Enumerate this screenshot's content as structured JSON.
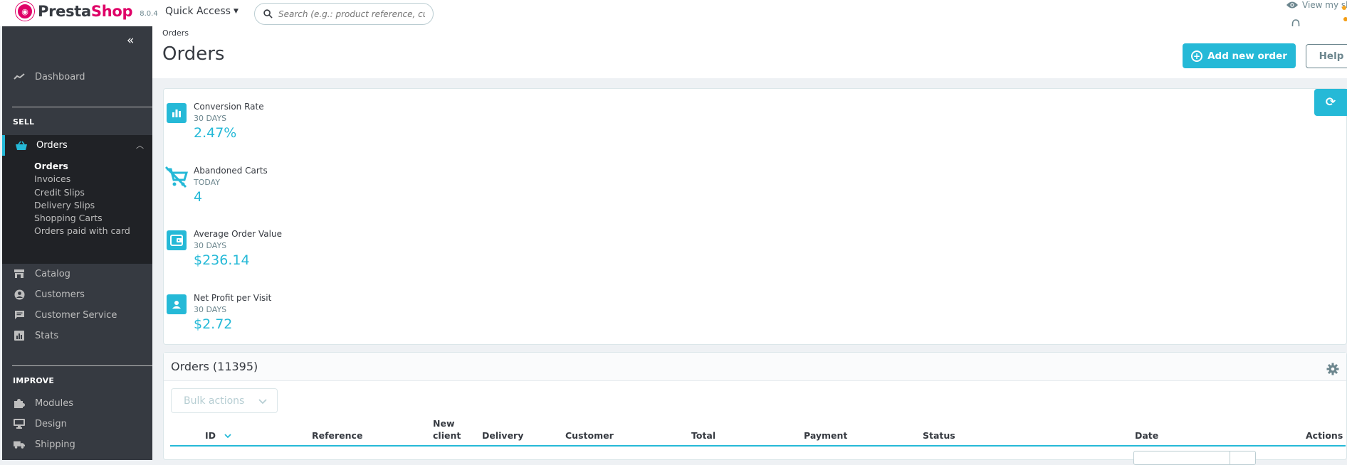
{
  "header": {
    "brand_presta": "Presta",
    "brand_shop": "Shop",
    "version": "8.0.4",
    "quick_access": "Quick Access",
    "search_placeholder": "Search (e.g.: product reference, custon",
    "view_shop": "View my sh"
  },
  "sidebar": {
    "dashboard": "Dashboard",
    "sell_title": "SELL",
    "orders": "Orders",
    "orders_sub": [
      "Orders",
      "Invoices",
      "Credit Slips",
      "Delivery Slips",
      "Shopping Carts",
      "Orders paid with card"
    ],
    "catalog": "Catalog",
    "customers": "Customers",
    "customer_service": "Customer Service",
    "stats": "Stats",
    "improve_title": "IMPROVE",
    "modules": "Modules",
    "design": "Design",
    "shipping": "Shipping"
  },
  "page": {
    "breadcrumb": "Orders",
    "title": "Orders",
    "add_new_order": "Add new order",
    "help": "Help"
  },
  "kpis": [
    {
      "title": "Conversion Rate",
      "period": "30 DAYS",
      "value": "2.47%"
    },
    {
      "title": "Abandoned Carts",
      "period": "TODAY",
      "value": "4"
    },
    {
      "title": "Average Order Value",
      "period": "30 DAYS",
      "value": "$236.14"
    },
    {
      "title": "Net Profit per Visit",
      "period": "30 DAYS",
      "value": "$2.72"
    }
  ],
  "orders_table": {
    "title": "Orders (11395)",
    "bulk_actions": "Bulk actions",
    "columns": {
      "id": "ID",
      "reference": "Reference",
      "new_client_1": "New",
      "new_client_2": "client",
      "delivery": "Delivery",
      "customer": "Customer",
      "total": "Total",
      "payment": "Payment",
      "status": "Status",
      "date": "Date",
      "actions": "Actions"
    }
  },
  "colors": {
    "accent": "#25b9d7",
    "brand": "#df0067",
    "sidebar_bg": "#363a41",
    "sidebar_active_bg": "#202226"
  }
}
